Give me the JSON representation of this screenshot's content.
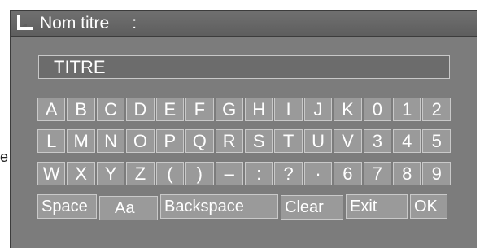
{
  "dialog": {
    "title": "Nom titre",
    "title_separator": ":",
    "title_icon": "return-arrow-icon"
  },
  "field": {
    "value": "TITRE"
  },
  "keyboard": {
    "rows": [
      [
        "A",
        "B",
        "C",
        "D",
        "E",
        "F",
        "G",
        "H",
        "I",
        "J",
        "K",
        "0",
        "1",
        "2"
      ],
      [
        "L",
        "M",
        "N",
        "O",
        "P",
        "Q",
        "R",
        "S",
        "T",
        "U",
        "V",
        "3",
        "4",
        "5"
      ],
      [
        "W",
        "X",
        "Y",
        "Z",
        "(",
        ")",
        "–",
        ":",
        "?",
        "·",
        "6",
        "7",
        "8",
        "9"
      ]
    ],
    "actions": {
      "space": "Space",
      "case": "Aa",
      "backspace": "Backspace",
      "clear": "Clear",
      "exit": "Exit",
      "ok": "OK"
    }
  },
  "page_edge_text": "e",
  "colors": {
    "panel": "#7c7c7c",
    "title_bar": "#666666",
    "key_fill": "#9a9a9a",
    "key_border": "#c9c9c9",
    "text": "#ffffff"
  }
}
